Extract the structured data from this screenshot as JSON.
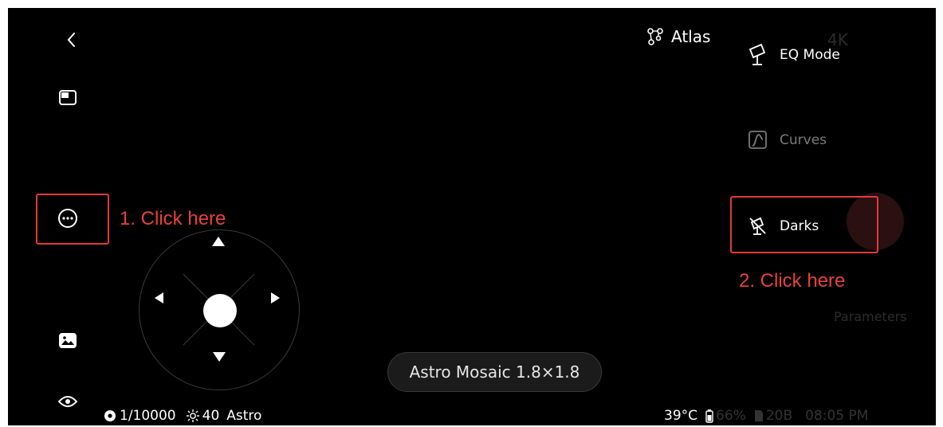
{
  "nav": {
    "back_icon": "chevron-left-icon"
  },
  "left_toolbar": [
    {
      "name": "layout-icon"
    },
    {
      "name": "more-icon"
    },
    {
      "name": "gallery-icon"
    },
    {
      "name": "eye-icon"
    }
  ],
  "annotations": {
    "step1": "1. Click here",
    "step2": "2. Click here",
    "color": "#e33a3a"
  },
  "atlas": {
    "label": "Atlas",
    "icon": "constellation-icon"
  },
  "menu": {
    "items": [
      {
        "label": "EQ Mode",
        "icon": "telescope-icon",
        "state": "active"
      },
      {
        "label": "Curves",
        "icon": "curves-icon",
        "state": "dim"
      },
      {
        "label": "Darks",
        "icon": "darks-icon",
        "state": "active"
      }
    ]
  },
  "background_ghost": {
    "top_right_label": "4K",
    "parameters_label": "Parameters"
  },
  "mode_pill": {
    "label": "Astro Mosaic 1.8×1.8"
  },
  "status_left": {
    "shutter": "1/10000",
    "gain": "40",
    "mode": "Astro"
  },
  "status_right": {
    "temperature": "39°C",
    "battery": "66%",
    "storage": "20B",
    "time": "08:05 PM"
  }
}
